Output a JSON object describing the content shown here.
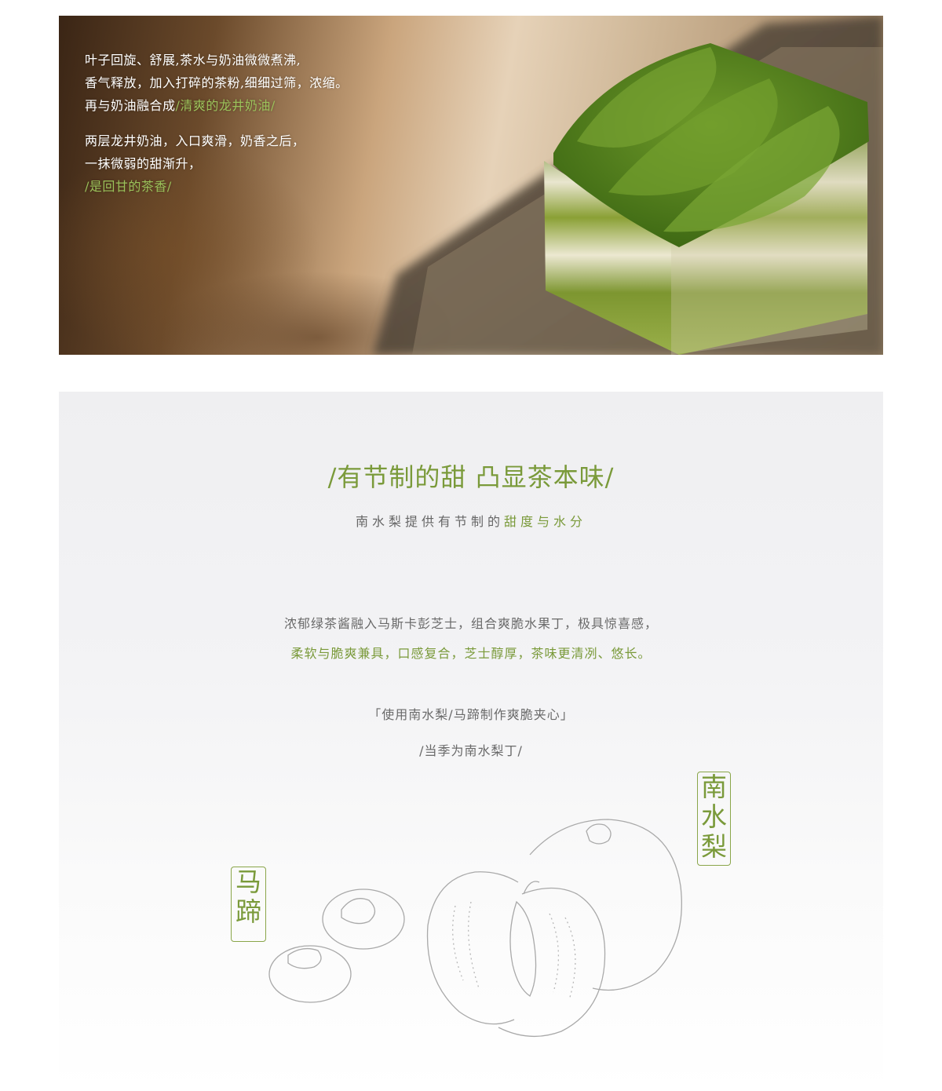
{
  "hero": {
    "para1": {
      "line1": "叶子回旋、舒展,茶水与奶油微微煮沸,",
      "line2": "香气释放，加入打碎的茶粉,细细过筛，浓缩。",
      "line3_plain": "再与奶油融合成",
      "line3_accent": "/清爽的龙井奶油/"
    },
    "para2": {
      "line1": "两层龙井奶油，入口爽滑，奶香之后，",
      "line2": "一抹微弱的甜渐升，",
      "line3_accent": "/是回甘的茶香/"
    }
  },
  "section": {
    "headline": "/有节制的甜 凸显茶本味/",
    "subline_plain": "南水梨提供有节制的",
    "subline_accent": "甜度与水分",
    "desc_line1": "浓郁绿茶酱融入马斯卡彭芝士，组合爽脆水果丁，极具惊喜感，",
    "desc_line2": "柔软与脆爽兼具，口感复合，芝士醇厚，茶味更清冽、悠长。",
    "note_line1": "「使用南水梨/马蹄制作爽脆夹心」",
    "note_line2": "/当季为南水梨丁/",
    "label_pear": [
      "南",
      "水",
      "梨"
    ],
    "label_chestnut": [
      "马",
      "蹄"
    ]
  },
  "colors": {
    "accent_green": "#7a9a3a",
    "body_gray": "#6a6a6a"
  }
}
